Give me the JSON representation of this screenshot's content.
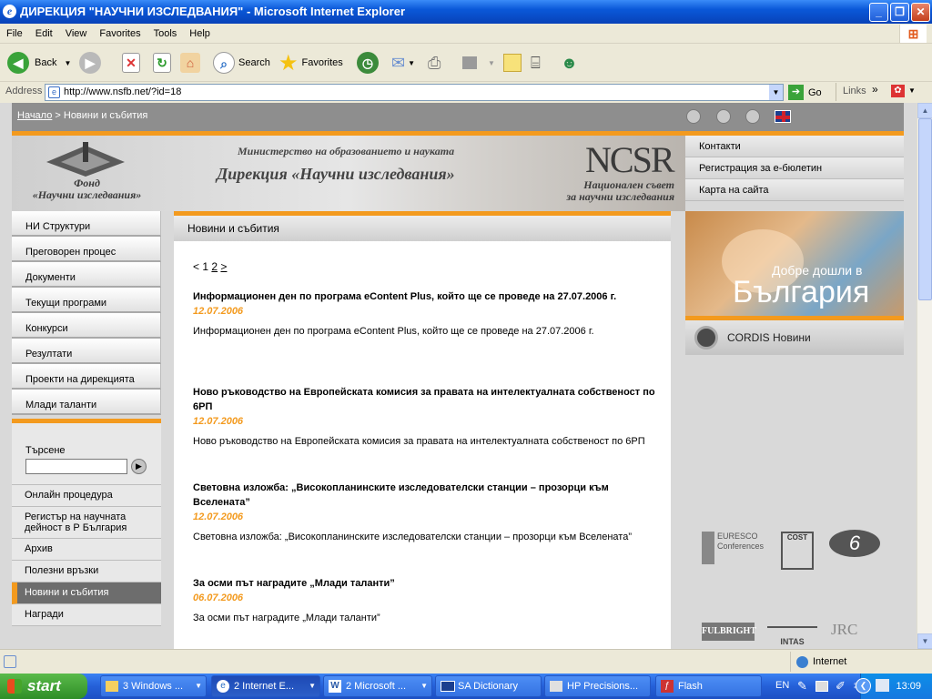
{
  "window": {
    "title": "ДИРЕКЦИЯ \"НАУЧНИ ИЗСЛЕДВАНИЯ\" - Microsoft Internet Explorer"
  },
  "menu": [
    "File",
    "Edit",
    "View",
    "Favorites",
    "Tools",
    "Help"
  ],
  "toolbar": {
    "back": "Back",
    "search": "Search",
    "favorites": "Favorites"
  },
  "address": {
    "label": "Address",
    "url": "http://www.nsfb.net/?id=18",
    "go": "Go",
    "links": "Links"
  },
  "page": {
    "breadcrumb": {
      "home": "Начало",
      "sep": " > ",
      "current": "Новини и събития"
    },
    "banner": {
      "fund_line1": "Фонд",
      "fund_line2": "«Научни изследвания»",
      "ministry": "Министерство на образованието и науката",
      "directorate": "Дирекция «Научни изследвания»",
      "nssr_logo": "NCSR",
      "council_line1": "Национален съвет",
      "council_line2": "за научни изследвания"
    },
    "right_menu": [
      "Контакти",
      "Регистрация за е-бюлетин",
      "Карта на сайта"
    ],
    "left_nav": [
      "НИ Структури",
      "Преговорен процес",
      "Документи",
      "Текущи програми",
      "Конкурси",
      "Резултати",
      "Проекти на дирекцията",
      "Млади таланти"
    ],
    "search": {
      "label": "Търсене"
    },
    "left_nav2": [
      "Онлайн процедура",
      "Регистър на научната дейност в Р България",
      "Архив",
      "Полезни връзки",
      "Новини и събития",
      "Награди"
    ],
    "news": {
      "header": "Новини и събития",
      "pager": {
        "prev": "<",
        "p1": "1",
        "p2": "2",
        "next": ">"
      },
      "articles": [
        {
          "title": "Информационен ден по програма eContent Plus, който ще се проведе на 27.07.2006 г.",
          "date": "12.07.2006",
          "summary": "Информационен ден по програма eContent Plus, който ще се проведе на 27.07.2006 г."
        },
        {
          "title": "Ново ръководство на Европейската комисия за правата на интелектуалната собственост по 6РП",
          "date": "12.07.2006",
          "summary": "Ново ръководство на Европейската комисия за правата на интелектуалната собственост по 6РП"
        },
        {
          "title": "Световна изложба: „Високопланинските изследователски станции – прозорци към Вселената”",
          "date": "12.07.2006",
          "summary": "Световна изложба: „Високопланинските изследователски станции – прозорци към Вселената”"
        },
        {
          "title": "За осми път наградите „Млади таланти”",
          "date": "06.07.2006",
          "summary": "За осми път наградите „Млади таланти”"
        }
      ]
    },
    "welcome": {
      "line1": "Добре дошли в",
      "line2": "България"
    },
    "cordis": {
      "label": "CORDIS Новини"
    },
    "partners": [
      "EURESCO Conferences",
      "COST",
      "6",
      "FULBRIGHT",
      "INTAS",
      "JRC"
    ]
  },
  "status": {
    "zone": "Internet"
  },
  "taskbar": {
    "start": "start",
    "tasks": [
      "3 Windows ...",
      "2 Internet E...",
      "2 Microsoft ...",
      "SA Dictionary",
      "HP Precisions...",
      "Flash"
    ],
    "lang": "EN",
    "clock": "13:09"
  }
}
